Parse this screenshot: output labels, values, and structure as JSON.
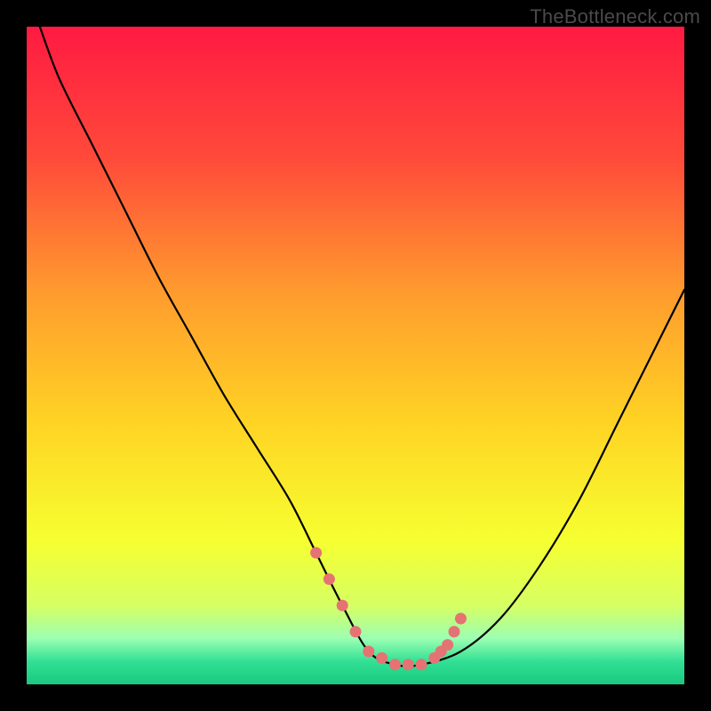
{
  "watermark": "TheBottleneck.com",
  "gradient": {
    "stops": [
      {
        "offset": 0.0,
        "color": "#ff1a42"
      },
      {
        "offset": 0.2,
        "color": "#ff4a3a"
      },
      {
        "offset": 0.4,
        "color": "#ff9a2e"
      },
      {
        "offset": 0.6,
        "color": "#ffd324"
      },
      {
        "offset": 0.78,
        "color": "#f6ff30"
      },
      {
        "offset": 0.88,
        "color": "#d6ff63"
      },
      {
        "offset": 0.93,
        "color": "#9cffb2"
      },
      {
        "offset": 0.965,
        "color": "#33e095"
      },
      {
        "offset": 1.0,
        "color": "#17c97f"
      }
    ]
  },
  "marker_color": "#e57373",
  "chart_data": {
    "type": "line",
    "title": "",
    "xlabel": "",
    "ylabel": "",
    "xlim": [
      0,
      100
    ],
    "ylim": [
      0,
      100
    ],
    "series": [
      {
        "name": "bottleneck-curve",
        "x": [
          2,
          5,
          10,
          15,
          20,
          25,
          30,
          35,
          40,
          44,
          48,
          52,
          56,
          60,
          66,
          72,
          78,
          84,
          90,
          96,
          100
        ],
        "values": [
          100,
          92,
          82,
          72,
          62,
          53,
          44,
          36,
          28,
          20,
          12,
          5,
          3,
          3,
          5,
          10,
          18,
          28,
          40,
          52,
          60
        ]
      }
    ],
    "markers": {
      "name": "highlight-points",
      "x": [
        44,
        46,
        48,
        50,
        52,
        54,
        56,
        58,
        60,
        62,
        63,
        64,
        65,
        66
      ],
      "values": [
        20,
        16,
        12,
        8,
        5,
        4,
        3,
        3,
        3,
        4,
        5,
        6,
        8,
        10
      ]
    }
  }
}
